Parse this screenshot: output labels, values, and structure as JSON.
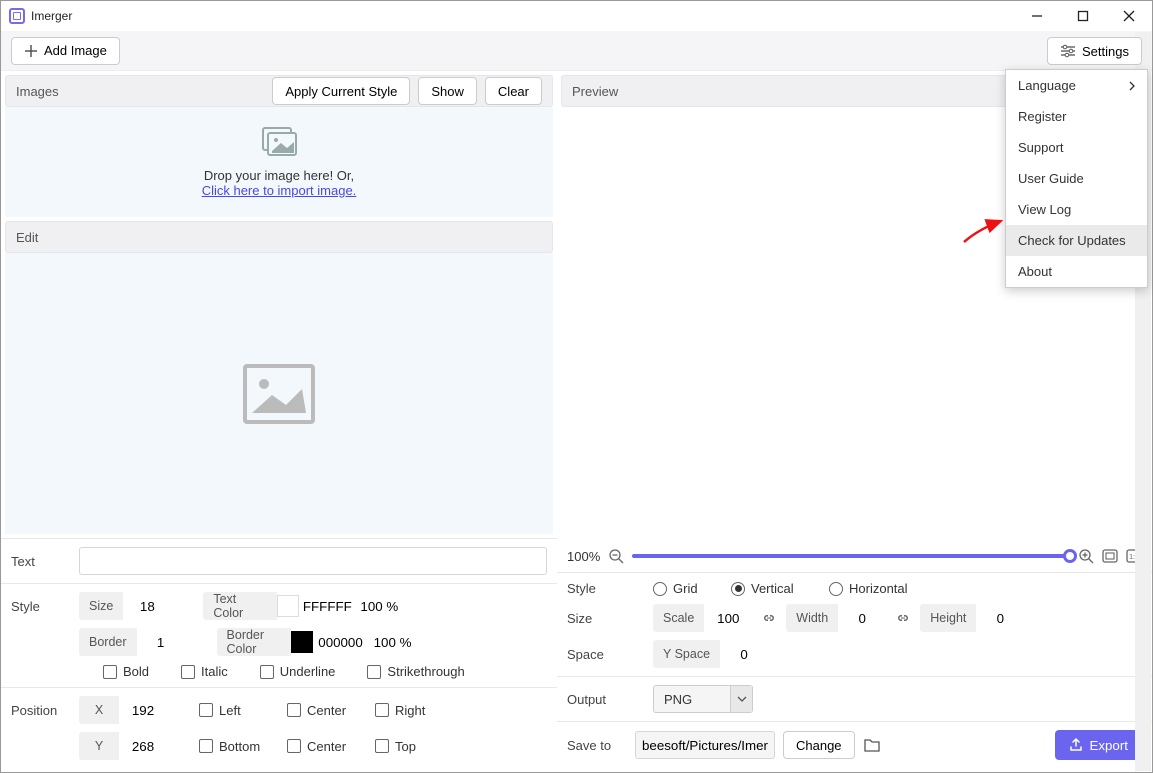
{
  "app": {
    "title": "Imerger"
  },
  "toolbar": {
    "add_image": "Add Image",
    "settings": "Settings"
  },
  "images": {
    "title": "Images",
    "apply": "Apply Current Style",
    "show": "Show",
    "clear": "Clear",
    "drop_text": "Drop your image here! Or,",
    "import_link": "Click here to import image."
  },
  "edit": {
    "title": "Edit"
  },
  "text_panel": {
    "label": "Text"
  },
  "style_panel": {
    "label": "Style",
    "size_lbl": "Size",
    "size_val": "18",
    "border_lbl": "Border",
    "border_val": "1",
    "text_color_lbl": "Text Color",
    "text_color_hex": "FFFFFF",
    "text_color_opacity": "100 %",
    "border_color_lbl": "Border Color",
    "border_color_hex": "000000",
    "border_color_opacity": "100 %",
    "bold": "Bold",
    "italic": "Italic",
    "underline": "Underline",
    "strike": "Strikethrough"
  },
  "position_panel": {
    "label": "Position",
    "x_lbl": "X",
    "x_val": "192",
    "y_lbl": "Y",
    "y_val": "268",
    "left": "Left",
    "center": "Center",
    "right": "Right",
    "bottom": "Bottom",
    "center2": "Center",
    "top": "Top"
  },
  "preview": {
    "title": "Preview",
    "zoom": "100%"
  },
  "preview_style": {
    "label": "Style",
    "grid": "Grid",
    "vertical": "Vertical",
    "horizontal": "Horizontal"
  },
  "preview_size": {
    "label": "Size",
    "scale_lbl": "Scale",
    "scale_val": "100",
    "width_lbl": "Width",
    "width_val": "0",
    "height_lbl": "Height",
    "height_val": "0"
  },
  "preview_space": {
    "label": "Space",
    "yspace_lbl": "Y Space",
    "yspace_val": "0"
  },
  "output": {
    "label": "Output",
    "format": "PNG"
  },
  "save": {
    "label": "Save to",
    "path": "beesoft/Pictures/Imerger",
    "change": "Change",
    "export": "Export"
  },
  "menu": {
    "language": "Language",
    "register": "Register",
    "support": "Support",
    "guide": "User Guide",
    "log": "View Log",
    "updates": "Check for Updates",
    "about": "About"
  }
}
